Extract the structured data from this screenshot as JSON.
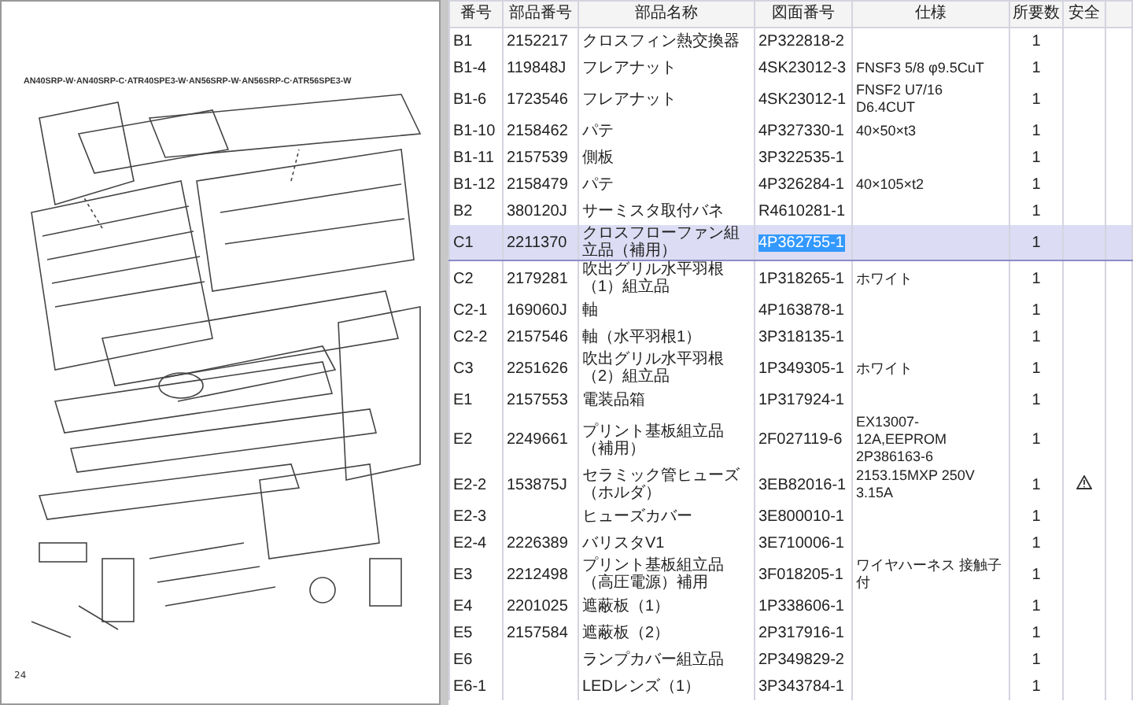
{
  "diagram": {
    "caption": "AN40SRP-W·AN40SRP-C·ATR40SPE3-W·AN56SRP-W·AN56SRP-C·ATR56SPE3-W",
    "page_number": "24"
  },
  "table": {
    "columns": [
      "番号",
      "部品番号",
      "部品名称",
      "図面番号",
      "仕様",
      "所要数",
      "安全"
    ],
    "rows": [
      {
        "no": "B1",
        "part_no": "2152217",
        "name": "クロスフィン熱交換器",
        "drawing_no": "2P322818-2",
        "qty": "1",
        "safety": false,
        "selected": false
      },
      {
        "no": "B1-4",
        "part_no": "119848J",
        "name": "フレアナット",
        "drawing_no": "4SK23012-3",
        "spec": "FNSF3 5/8 φ9.5CuT",
        "qty": "1",
        "safety": false,
        "selected": false
      },
      {
        "no": "B1-6",
        "part_no": "1723546",
        "name": "フレアナット",
        "drawing_no": "4SK23012-1",
        "spec": "FNSF2 U7/16 D6.4CUT",
        "qty": "1",
        "safety": false,
        "selected": false
      },
      {
        "no": "B1-10",
        "part_no": "2158462",
        "name": "パテ",
        "drawing_no": "4P327330-1",
        "spec": "40×50×t3",
        "qty": "1",
        "safety": false,
        "selected": false
      },
      {
        "no": "B1-11",
        "part_no": "2157539",
        "name": "側板",
        "drawing_no": "3P322535-1",
        "qty": "1",
        "safety": false,
        "selected": false
      },
      {
        "no": "B1-12",
        "part_no": "2158479",
        "name": "パテ",
        "drawing_no": "4P326284-1",
        "spec": "40×105×t2",
        "qty": "1",
        "safety": false,
        "selected": false
      },
      {
        "no": "B2",
        "part_no": "380120J",
        "name": "サーミスタ取付バネ",
        "drawing_no": "R4610281-1",
        "qty": "1",
        "safety": false,
        "selected": false
      },
      {
        "no": "C1",
        "part_no": "2211370",
        "name": "クロスフローファン組立品（補用）",
        "drawing_no": "4P362755-1",
        "qty": "1",
        "safety": false,
        "selected": true
      },
      {
        "no": "C2",
        "part_no": "2179281",
        "name": "吹出グリル水平羽根（1）組立品",
        "drawing_no": "1P318265-1",
        "spec": "ホワイト",
        "qty": "1",
        "safety": false,
        "selected": false
      },
      {
        "no": "C2-1",
        "part_no": "169060J",
        "name": "軸",
        "drawing_no": "4P163878-1",
        "qty": "1",
        "safety": false,
        "selected": false
      },
      {
        "no": "C2-2",
        "part_no": "2157546",
        "name": "軸（水平羽根1）",
        "drawing_no": "3P318135-1",
        "qty": "1",
        "safety": false,
        "selected": false
      },
      {
        "no": "C3",
        "part_no": "2251626",
        "name": "吹出グリル水平羽根（2）組立品",
        "drawing_no": "1P349305-1",
        "spec": "ホワイト",
        "qty": "1",
        "safety": false,
        "selected": false
      },
      {
        "no": "E1",
        "part_no": "2157553",
        "name": "電装品箱",
        "drawing_no": "1P317924-1",
        "qty": "1",
        "safety": false,
        "selected": false
      },
      {
        "no": "E2",
        "part_no": "2249661",
        "name": "プリント基板組立品（補用）",
        "drawing_no": "2F027119-6",
        "spec": "EX13007-12A,EEPROM 2P386163-6",
        "qty": "1",
        "safety": false,
        "selected": false
      },
      {
        "no": "E2-2",
        "part_no": "153875J",
        "name": "セラミック管ヒューズ（ホルダ）",
        "drawing_no": "3EB82016-1",
        "spec": "2153.15MXP 250V 3.15A",
        "qty": "1",
        "safety": true,
        "selected": false
      },
      {
        "no": "E2-3",
        "name": "ヒューズカバー",
        "drawing_no": "3E800010-1",
        "qty": "1",
        "safety": false,
        "selected": false
      },
      {
        "no": "E2-4",
        "part_no": "2226389",
        "name": "バリスタV1",
        "drawing_no": "3E710006-1",
        "qty": "1",
        "safety": false,
        "selected": false
      },
      {
        "no": "E3",
        "part_no": "2212498",
        "name": "プリント基板組立品（高圧電源）補用",
        "drawing_no": "3F018205-1",
        "spec": "ワイヤハーネス 接触子付",
        "qty": "1",
        "safety": false,
        "selected": false
      },
      {
        "no": "E4",
        "part_no": "2201025",
        "name": "遮蔽板（1）",
        "drawing_no": "1P338606-1",
        "qty": "1",
        "safety": false,
        "selected": false
      },
      {
        "no": "E5",
        "part_no": "2157584",
        "name": "遮蔽板（2）",
        "drawing_no": "2P317916-1",
        "qty": "1",
        "safety": false,
        "selected": false
      },
      {
        "no": "E6",
        "name": "ランプカバー組立品",
        "drawing_no": "2P349829-2",
        "qty": "1",
        "safety": false,
        "selected": false
      },
      {
        "no": "E6-1",
        "name": "LEDレンズ（1）",
        "drawing_no": "3P343784-1",
        "qty": "1",
        "safety": false,
        "selected": false
      }
    ]
  }
}
